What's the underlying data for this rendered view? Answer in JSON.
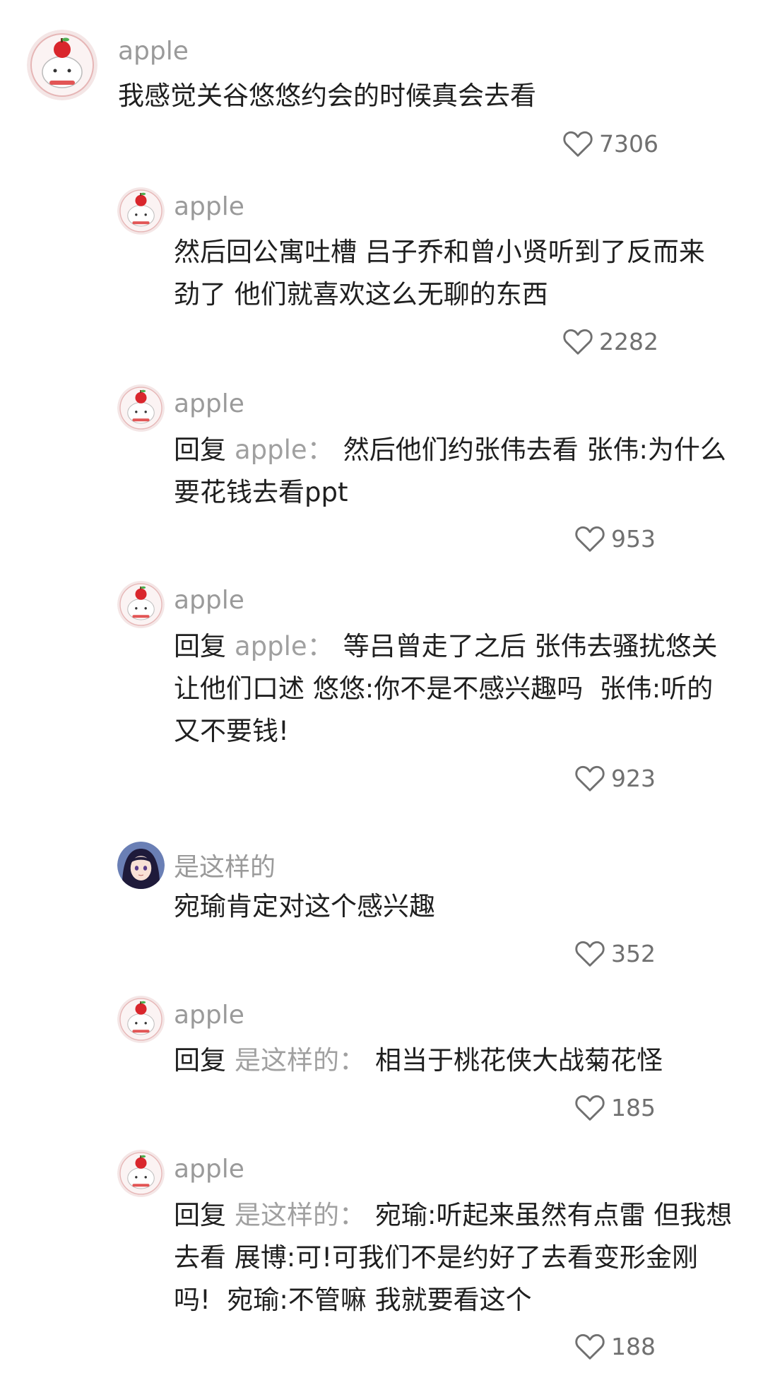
{
  "comments": [
    {
      "user": "apple",
      "text": "我感觉关谷悠悠约会的时候真会去看",
      "likes": "7306"
    },
    {
      "user": "apple",
      "text": "然后回公寓吐槽 吕子乔和曾小贤听到了反而来\n劲了 他们就喜欢这么无聊的东西",
      "likes": "2282"
    },
    {
      "user": "apple",
      "reply_label": "回复",
      "reply_to": "apple",
      "text": "然后他们约张伟去看 张伟:为什么\n要花钱去看ppt",
      "likes": "953"
    },
    {
      "user": "apple",
      "reply_label": "回复",
      "reply_to": "apple",
      "text": "等吕曾走了之后 张伟去骚扰悠关\n让他们口述 悠悠:你不是不感兴趣吗  张伟:听的\n又不要钱!",
      "likes": "923"
    },
    {
      "user": "是这样的",
      "text": "宛瑜肯定对这个感兴趣",
      "likes": "352"
    },
    {
      "user": "apple",
      "reply_label": "回复",
      "reply_to": "是这样的",
      "text": "相当于桃花侠大战菊花怪",
      "likes": "185"
    },
    {
      "user": "apple",
      "reply_label": "回复",
      "reply_to": "是这样的",
      "text": "宛瑜:听起来虽然有点雷 但我想\n去看 展博:可!可我们不是约好了去看变形金刚\n吗!  宛瑜:不管嘛 我就要看这个",
      "likes": "188"
    }
  ],
  "colon": "："
}
